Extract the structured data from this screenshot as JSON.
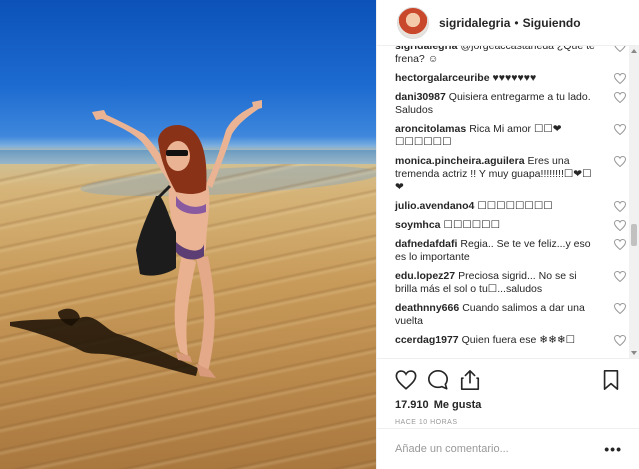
{
  "post": {
    "username": "sigridalegria",
    "separator": "•",
    "follow_status": "Siguiendo"
  },
  "comments": [
    {
      "user": "sigridalegria",
      "text": "@jorgeaccastaneda ¿Qué te frena? ☺"
    },
    {
      "user": "hectorgalarceuribe",
      "text": "♥♥♥♥♥♥♥"
    },
    {
      "user": "dani30987",
      "text": "Quisiera entregarme a tu lado. Saludos"
    },
    {
      "user": "aroncitolamas",
      "text": "Rica Mi amor ☐☐❤☐☐☐☐☐☐"
    },
    {
      "user": "monica.pincheira.aguilera",
      "text": "Eres una tremenda actriz !! Y muy guapa!!!!!!!!☐❤☐❤"
    },
    {
      "user": "julio.avendano4",
      "text": "☐☐☐☐☐☐☐☐"
    },
    {
      "user": "soymhca",
      "text": "☐☐☐☐☐☐"
    },
    {
      "user": "dafnedafdafi",
      "text": "Regia.. Se te ve feliz...y eso es lo importante"
    },
    {
      "user": "edu.lopez27",
      "text": "Preciosa sigrid... No se si brilla más el sol o tu☐...saludos"
    },
    {
      "user": "deathnny666",
      "text": "Cuando salimos a dar una vuelta"
    },
    {
      "user": "ccerdag1977",
      "text": "Quien fuera ese ❄❄❄☐"
    }
  ],
  "stats": {
    "likes_count": "17.910",
    "likes_label": "Me gusta",
    "time_ago": "Hace 10 horas"
  },
  "add_comment": {
    "placeholder": "Añade un comentario...",
    "more": "•••"
  },
  "icons": {
    "like": "heart-icon",
    "comment": "comment-icon",
    "share": "share-icon",
    "save": "bookmark-icon",
    "comment_like": "heart-icon"
  }
}
